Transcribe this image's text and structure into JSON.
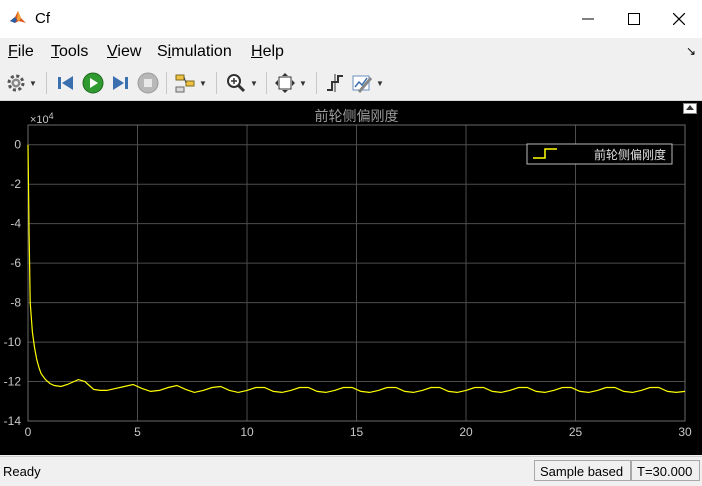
{
  "window": {
    "title": "Cf"
  },
  "menu": [
    {
      "label": "File",
      "accel": "F",
      "rest": "ile"
    },
    {
      "label": "Tools",
      "accel": "T",
      "rest": "ools"
    },
    {
      "label": "View",
      "accel": "V",
      "rest": "iew"
    },
    {
      "label": "Simulation",
      "accel": "i",
      "pre": "S",
      "rest": "mulation"
    },
    {
      "label": "Help",
      "accel": "H",
      "rest": "elp"
    }
  ],
  "toolbar_icons": [
    "gear-icon",
    "step-back-icon",
    "run-icon",
    "step-forward-icon",
    "stop-icon",
    "highlight-icon",
    "zoom-icon",
    "fit-icon",
    "cursor-measure-icon",
    "style-icon"
  ],
  "colors": {
    "plot_bg": "#000000",
    "grid": "#4d4d4d",
    "axis_text": "#c8c8c8",
    "line": "#ffff00",
    "title": "#9a9a9a"
  },
  "chart_data": {
    "type": "line",
    "title": "前轮侧偏刚度",
    "exponent_label": "×10",
    "exponent": "4",
    "xlim": [
      0,
      30
    ],
    "ylim": [
      -14,
      1
    ],
    "xticks": [
      "0",
      "5",
      "10",
      "15",
      "20",
      "25",
      "30"
    ],
    "xtick_values": [
      0,
      5,
      10,
      15,
      20,
      25,
      30
    ],
    "yticks": [
      "0",
      "-2",
      "-4",
      "-6",
      "-8",
      "-10",
      "-12",
      "-14"
    ],
    "ytick_values": [
      0,
      -2,
      -4,
      -6,
      -8,
      -10,
      -12,
      -14
    ],
    "grid": true,
    "legend": {
      "placement": "top-right",
      "entries": [
        "前轮侧偏刚度"
      ]
    },
    "series": [
      {
        "name": "前轮侧偏刚度",
        "x": [
          0,
          0.05,
          0.1,
          0.2,
          0.3,
          0.4,
          0.5,
          0.6,
          0.8,
          1.0,
          1.2,
          1.5,
          1.8,
          2.0,
          2.3,
          2.6,
          2.8,
          3.0,
          3.3,
          3.6,
          4.0,
          4.4,
          4.8,
          5.2,
          5.6,
          6.0,
          6.4,
          6.8,
          7.2,
          7.6,
          8.0,
          8.4,
          8.8,
          9.2,
          9.6,
          10.0,
          10.4,
          10.8,
          11.2,
          11.6,
          12.0,
          12.4,
          12.8,
          13.2,
          13.6,
          14.0,
          14.4,
          14.8,
          15.2,
          15.6,
          16.0,
          16.4,
          16.8,
          17.2,
          17.6,
          18.0,
          18.4,
          18.8,
          19.2,
          19.6,
          20.0,
          20.4,
          20.8,
          21.2,
          21.6,
          22.0,
          22.4,
          22.8,
          23.2,
          23.6,
          24.0,
          24.4,
          24.8,
          25.2,
          25.6,
          26.0,
          26.4,
          26.8,
          27.2,
          27.6,
          28.0,
          28.4,
          28.8,
          29.2,
          29.6,
          30.0
        ],
        "y": [
          0,
          -4.5,
          -8.0,
          -9.5,
          -10.3,
          -10.9,
          -11.3,
          -11.6,
          -11.9,
          -12.1,
          -12.2,
          -12.25,
          -12.15,
          -12.05,
          -11.9,
          -12.0,
          -12.2,
          -12.4,
          -12.45,
          -12.45,
          -12.35,
          -12.25,
          -12.15,
          -12.35,
          -12.5,
          -12.45,
          -12.3,
          -12.2,
          -12.4,
          -12.55,
          -12.45,
          -12.3,
          -12.25,
          -12.45,
          -12.55,
          -12.45,
          -12.3,
          -12.3,
          -12.5,
          -12.55,
          -12.45,
          -12.3,
          -12.3,
          -12.5,
          -12.55,
          -12.45,
          -12.3,
          -12.3,
          -12.5,
          -12.55,
          -12.45,
          -12.3,
          -12.3,
          -12.5,
          -12.55,
          -12.45,
          -12.3,
          -12.3,
          -12.5,
          -12.55,
          -12.45,
          -12.3,
          -12.3,
          -12.5,
          -12.55,
          -12.45,
          -12.3,
          -12.3,
          -12.5,
          -12.55,
          -12.45,
          -12.3,
          -12.3,
          -12.5,
          -12.55,
          -12.45,
          -12.3,
          -12.3,
          -12.5,
          -12.55,
          -12.45,
          -12.3,
          -12.3,
          -12.5,
          -12.55,
          -12.5
        ]
      }
    ]
  },
  "status": {
    "text": "Ready",
    "sample": "Sample based",
    "time": "T=30.000"
  }
}
